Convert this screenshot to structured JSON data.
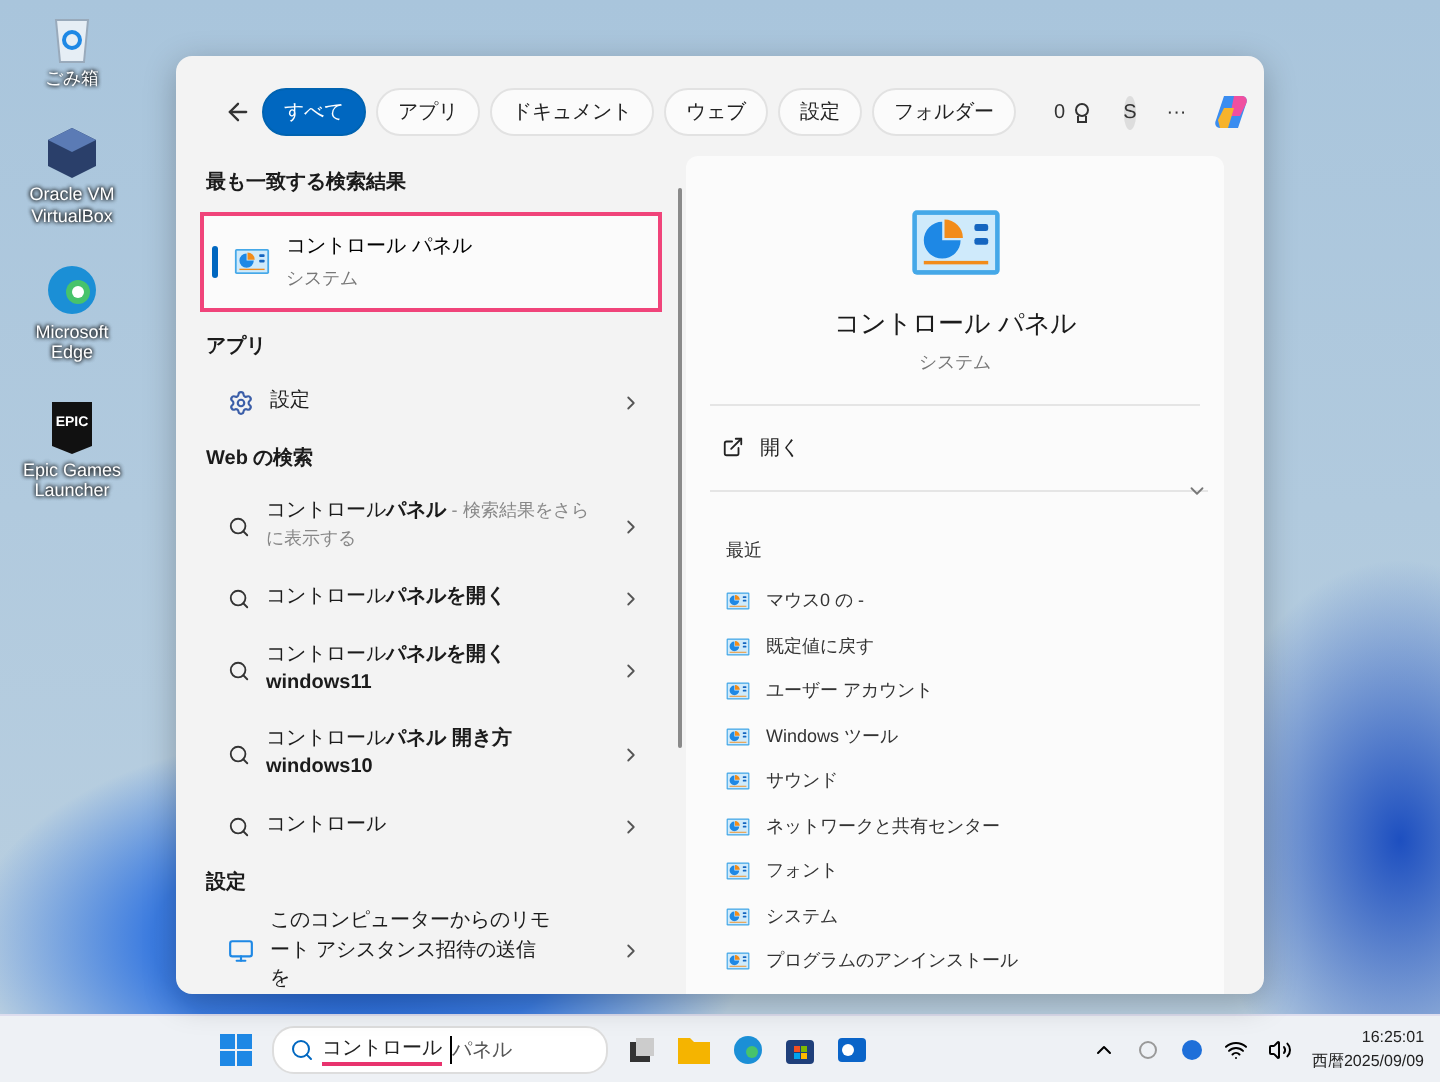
{
  "desktop_icons": [
    {
      "kind": "recycle",
      "label": "ごみ箱"
    },
    {
      "kind": "box",
      "label": "Oracle VM VirtualBox"
    },
    {
      "kind": "edge",
      "label": "Microsoft Edge"
    },
    {
      "kind": "epic",
      "label": "Epic Games Launcher",
      "logo": "EPIC"
    }
  ],
  "filters": [
    {
      "label": "すべて",
      "selected": true
    },
    {
      "label": "アプリ",
      "selected": false
    },
    {
      "label": "ドキュメント",
      "selected": false
    },
    {
      "label": "ウェブ",
      "selected": false
    },
    {
      "label": "設定",
      "selected": false
    },
    {
      "label": "フォルダー",
      "selected": false
    }
  ],
  "header": {
    "points": "0",
    "avatar": "S",
    "more": "···"
  },
  "best_match": {
    "heading": "最も一致する検索結果",
    "title": "コントロール パネル",
    "subtitle": "システム",
    "selected": true
  },
  "sections": [
    {
      "heading": "アプリ",
      "items": [
        {
          "kind": "gear",
          "text": "設定"
        }
      ]
    },
    {
      "heading": "Web の検索",
      "items": [
        {
          "kind": "search",
          "text": "コントロール**パネル**",
          "note": "- 検索結果をさらに表示する"
        },
        {
          "kind": "search",
          "text": "コントロール**パネルを開く**"
        },
        {
          "kind": "search",
          "text": "コントロール**パネルを開く**\n**windows11**"
        },
        {
          "kind": "search",
          "text": "コントロール**パネル 開き方**\n**windows10**"
        },
        {
          "kind": "search",
          "text": "コントロール"
        }
      ]
    },
    {
      "heading": "設定",
      "items": [
        {
          "kind": "monitor",
          "text": "このコンピューターからのリモート アシスタンス招待の送信を"
        }
      ]
    }
  ],
  "preview": {
    "title": "コントロール パネル",
    "subtitle": "システム",
    "open_label": "開く",
    "recent_heading": "最近",
    "recent": [
      "マウス0 の -",
      "既定値に戻す",
      "ユーザー アカウント",
      "Windows ツール",
      "サウンド",
      "ネットワークと共有センター",
      "フォント",
      "システム",
      "プログラムのアンインストール"
    ]
  },
  "taskbar": {
    "search": {
      "composing": "コントロール",
      "rest": "パネル"
    },
    "time": "16:25:01",
    "date": "西暦2025/09/09"
  }
}
